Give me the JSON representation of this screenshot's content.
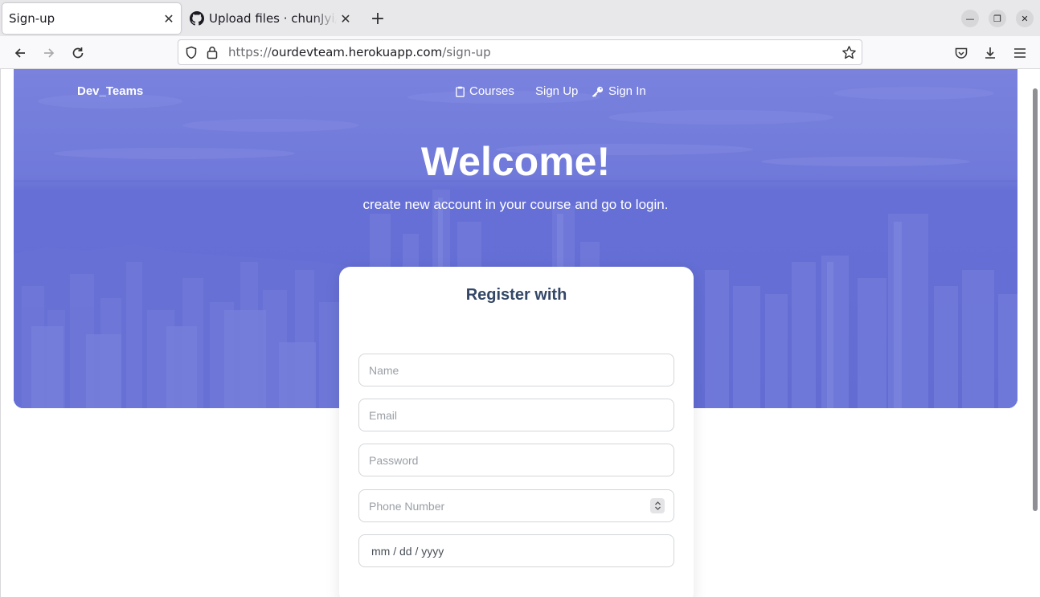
{
  "browser": {
    "tabs": [
      {
        "title": "Sign-up",
        "active": true
      },
      {
        "title": "Upload files · chunJyi/DevTeams",
        "active": false
      }
    ],
    "new_tab_icon": "plus-icon",
    "url": {
      "scheme": "https://",
      "host": "ourdevteam.herokuapp.com",
      "path": "/sign-up"
    },
    "window_controls": [
      "minimize-icon",
      "restore-icon",
      "close-icon"
    ]
  },
  "site": {
    "brand": "Dev_Teams",
    "nav": [
      {
        "label": "Courses",
        "icon": "clipboard-icon"
      },
      {
        "label": "Sign Up",
        "icon": ""
      },
      {
        "label": "Sign In",
        "icon": "key-icon"
      }
    ],
    "hero": {
      "title": "Welcome!",
      "subtitle": "create new account in your course and go to login."
    },
    "form": {
      "title": "Register with",
      "name_placeholder": "Name",
      "email_placeholder": "Email",
      "password_placeholder": "Password",
      "phone_placeholder": "Phone Number",
      "date_placeholder": "mm / dd / yyyy"
    }
  },
  "colors": {
    "hero_overlay": "#6a73d8",
    "card_title": "#344767",
    "input_border": "#d2d6da"
  }
}
